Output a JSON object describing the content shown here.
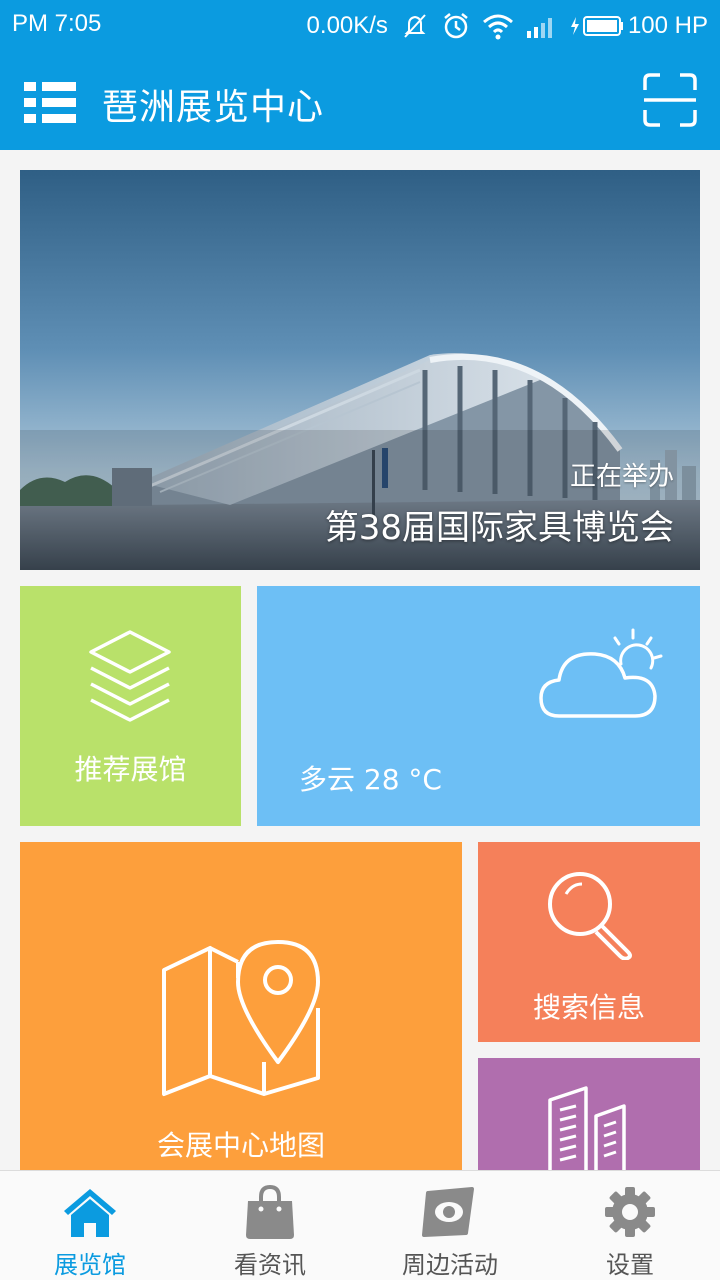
{
  "status_bar": {
    "time": "PM 7:05",
    "network_speed": "0.00K/s",
    "icons": [
      "mute-icon",
      "alarm-icon",
      "wifi-icon",
      "signal-icon",
      "battery-icon"
    ],
    "battery_label": "100 HP"
  },
  "app_bar": {
    "title": "琶洲展览中心",
    "menu_icon": "menu-list-icon",
    "scan_icon": "scan-icon"
  },
  "banner": {
    "status": "正在举办",
    "event_title": "第38届国际家具博览会"
  },
  "tiles": {
    "recommend": {
      "label": "推荐展馆",
      "icon": "layers-icon",
      "color": "#b9e16a"
    },
    "weather": {
      "text": "多云 28 °C",
      "icon": "partly-cloudy-icon",
      "color": "#6dbff5"
    },
    "map": {
      "label": "会展中心地图",
      "icon": "map-pin-icon",
      "color": "#fd9f3c"
    },
    "search": {
      "label": "搜索信息",
      "icon": "search-icon",
      "color": "#f5805a"
    },
    "building": {
      "icon": "buildings-icon",
      "color": "#b06eae"
    }
  },
  "bottom_nav": {
    "active_color": "#0b9be0",
    "items": [
      {
        "label": "展览馆",
        "icon": "home-icon",
        "active": true
      },
      {
        "label": "看资讯",
        "icon": "shopping-bag-icon",
        "active": false
      },
      {
        "label": "周边活动",
        "icon": "eye-icon",
        "active": false
      },
      {
        "label": "设置",
        "icon": "gear-icon",
        "active": false
      }
    ]
  }
}
